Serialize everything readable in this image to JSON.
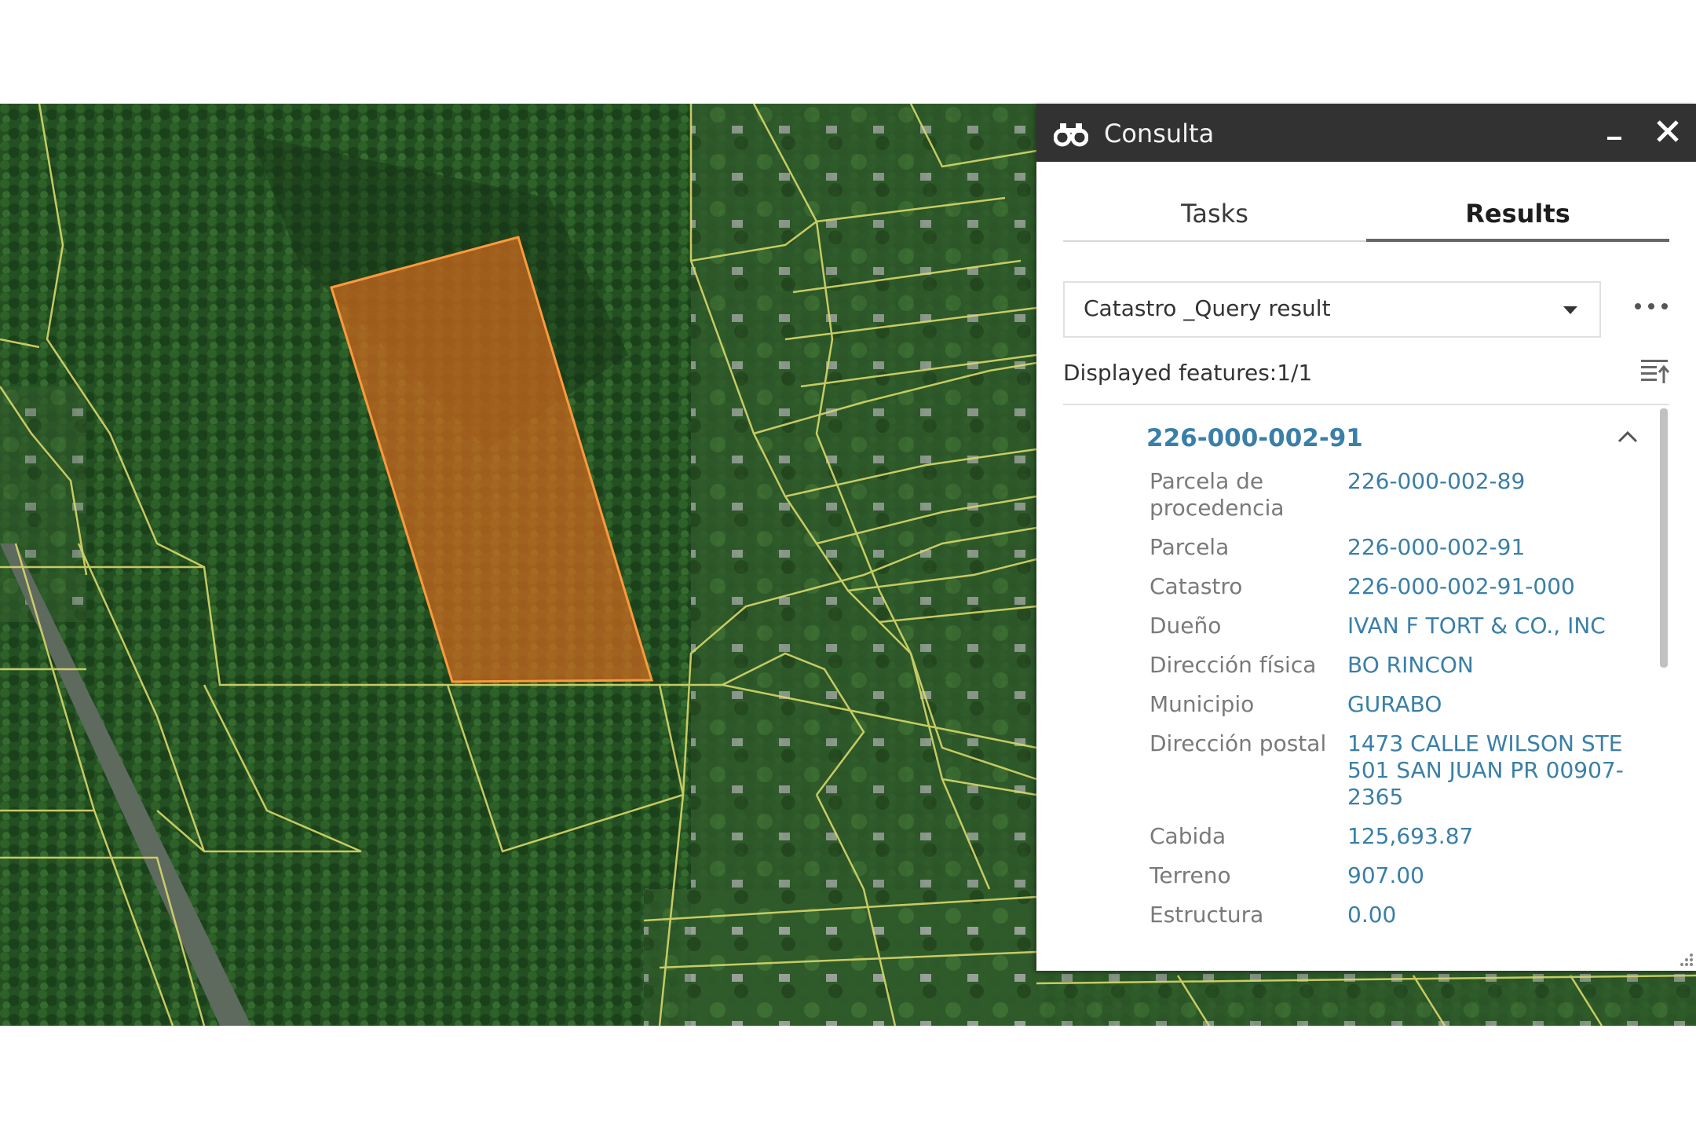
{
  "panel": {
    "title": "Consulta",
    "icon": "binoculars-icon",
    "minimize_icon": "minimize-icon",
    "close_icon": "close-icon"
  },
  "tabs": [
    {
      "label": "Tasks",
      "selected": false
    },
    {
      "label": "Results",
      "selected": true
    }
  ],
  "query": {
    "selected_value": "Catastro _Query result",
    "more_icon": "more-options-icon"
  },
  "features": {
    "count_text": "Displayed features:1/1",
    "sort_icon": "sort-icon"
  },
  "result": {
    "title": "226-000-002-91",
    "collapse_icon": "chevron-up-icon",
    "attributes": [
      {
        "label": "Parcela de procedencia",
        "value": "226-000-002-89"
      },
      {
        "label": "Parcela",
        "value": "226-000-002-91"
      },
      {
        "label": "Catastro",
        "value": "226-000-002-91-000"
      },
      {
        "label": "Dueño",
        "value": "IVAN F TORT & CO., INC"
      },
      {
        "label": "Dirección física",
        "value": "BO RINCON"
      },
      {
        "label": "Municipio",
        "value": "GURABO"
      },
      {
        "label": "Dirección postal",
        "value": "1473 CALLE WILSON STE 501 SAN JUAN PR 00907-2365"
      },
      {
        "label": "Cabida",
        "value": "125,693.87"
      },
      {
        "label": "Terreno",
        "value": "907.00"
      },
      {
        "label": "Estructura",
        "value": "0.00"
      }
    ]
  },
  "colors": {
    "header": "#323232",
    "link": "#3a7fa8",
    "highlight_parcel": "#d2691e",
    "parcel_lines": "#d8d86a",
    "vegetation": "#1f4a1f"
  }
}
